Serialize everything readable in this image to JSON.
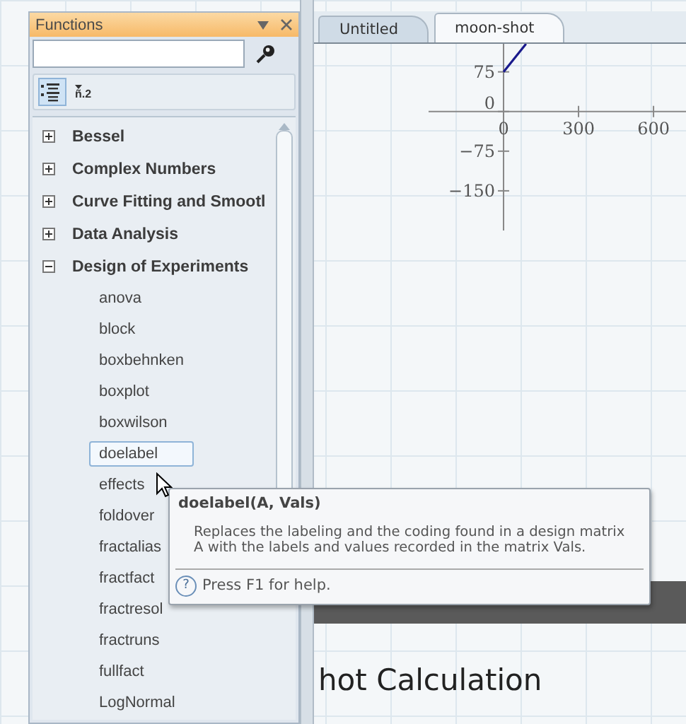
{
  "panel": {
    "title": "Functions",
    "sort_label": "ñ.2",
    "tree": [
      {
        "label": "Bessel",
        "expanded": false
      },
      {
        "label": "Complex Numbers",
        "expanded": false
      },
      {
        "label": "Curve Fitting and Smootl",
        "expanded": false
      },
      {
        "label": "Data Analysis",
        "expanded": false
      },
      {
        "label": "Design of Experiments",
        "expanded": true,
        "children": [
          {
            "label": "anova",
            "selected": false
          },
          {
            "label": "block",
            "selected": false
          },
          {
            "label": "boxbehnken",
            "selected": false
          },
          {
            "label": "boxplot",
            "selected": false
          },
          {
            "label": "boxwilson",
            "selected": false
          },
          {
            "label": "doelabel",
            "selected": true
          },
          {
            "label": "effects",
            "selected": false
          },
          {
            "label": "foldover",
            "selected": false
          },
          {
            "label": "fractalias",
            "selected": false
          },
          {
            "label": "fractfact",
            "selected": false
          },
          {
            "label": "fractresol",
            "selected": false
          },
          {
            "label": "fractruns",
            "selected": false
          },
          {
            "label": "fullfact",
            "selected": false
          },
          {
            "label": "LogNormal",
            "selected": false
          }
        ]
      }
    ]
  },
  "tabs": [
    {
      "label": "Untitled",
      "selected": false
    },
    {
      "label": "moon-shot",
      "selected": true
    }
  ],
  "worksheet": {
    "chart_data": {
      "type": "line",
      "x": [
        0,
        90
      ],
      "series": [
        {
          "color": "#1a1a8c",
          "values": [
            75,
            128
          ]
        }
      ],
      "xlim": [
        -300,
        730
      ],
      "ylim": [
        -225,
        128
      ],
      "xticks": [
        0,
        300,
        600
      ],
      "yticks": [
        -150,
        -75,
        0,
        75
      ]
    },
    "heading": "hot Calculation"
  },
  "tooltip": {
    "title": "doelabel(A, Vals)",
    "description": "Replaces the labeling and the coding found in a design matrix A with the labels and values recorded in the matrix Vals.",
    "help": "Press F1 for help.",
    "help_icon": "?"
  }
}
